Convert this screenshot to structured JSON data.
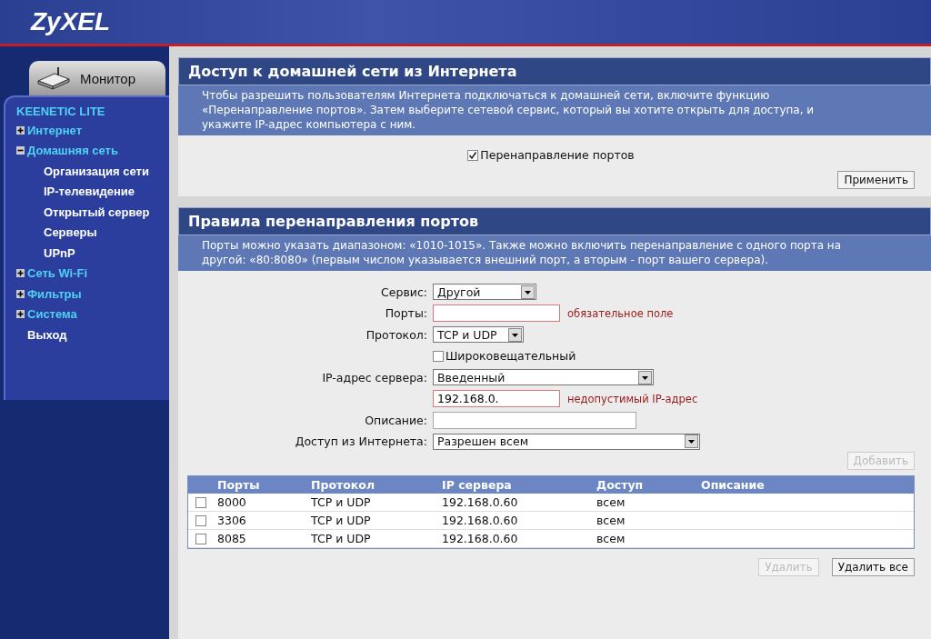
{
  "header": {
    "logo": "ZyXEL"
  },
  "sidebar": {
    "tab": "Монитор",
    "device": "KEENETIC LITE",
    "items": [
      {
        "label": "Интернет",
        "expanded": false
      },
      {
        "label": "Домашняя сеть",
        "expanded": true,
        "children": [
          {
            "label": "Организация сети"
          },
          {
            "label": "IP-телевидение"
          },
          {
            "label": "Открытый сервер"
          },
          {
            "label": "Серверы"
          },
          {
            "label": "UPnP"
          }
        ]
      },
      {
        "label": "Сеть Wi-Fi",
        "expanded": false
      },
      {
        "label": "Фильтры",
        "expanded": false
      },
      {
        "label": "Система",
        "expanded": false
      },
      {
        "label": "Выход"
      }
    ]
  },
  "access_section": {
    "title": "Доступ к домашней сети из Интернета",
    "description": "Чтобы разрешить пользователям Интернета подключаться к домашней сети, включите функцию «Перенаправление портов». Затем выберите сетевой сервис, который вы хотите открыть для доступа, и укажите IP-адрес компьютера с ним.",
    "checkbox": {
      "label": "Перенаправление портов",
      "checked": true
    },
    "apply_button": "Применить"
  },
  "rules_section": {
    "title": "Правила перенаправления портов",
    "description": "Порты можно указать диапазоном: «1010-1015». Также можно включить перенаправление с одного порта на другой: «80:8080» (первым числом указывается внешний порт, а вторым - порт вашего сервера).",
    "form": [
      {
        "kind": "select",
        "label": "Сервис:",
        "value": "Другой"
      },
      {
        "kind": "input",
        "label": "Порты:",
        "error": "обязательное поле",
        "invalid": true
      },
      {
        "kind": "select",
        "label": "Протокол:",
        "value": "TCP и UDP"
      },
      {
        "kind": "checkbox",
        "value": "Широковещательный",
        "checked": false
      },
      {
        "kind": "select",
        "label": "IP-адрес сервера:",
        "value": "Введенный"
      },
      {
        "kind": "input",
        "value": "192.168.0.",
        "error": "недопустимый IP-адрес",
        "invalid": true
      },
      {
        "kind": "input",
        "label": "Описание:",
        "invalid": false
      },
      {
        "kind": "select",
        "label": "Доступ из Интернета:",
        "value": "Разрешен всем"
      }
    ],
    "add_button": {
      "label": "Добавить",
      "disabled": true
    },
    "table": {
      "columns": [
        "Порты",
        "Протокол",
        "IP сервера",
        "Доступ",
        "Описание"
      ],
      "rows": [
        {
          "checked": false,
          "cells": [
            "8000",
            "TCP и UDP",
            "192.168.0.60",
            "всем"
          ]
        },
        {
          "checked": false,
          "cells": [
            "3306",
            "TCP и UDP",
            "192.168.0.60",
            "всем"
          ]
        },
        {
          "checked": false,
          "cells": [
            "8085",
            "TCP и UDP",
            "192.168.0.60",
            "всем"
          ]
        }
      ]
    },
    "buttons": [
      {
        "label": "Удалить",
        "disabled": true
      },
      {
        "label": "Удалить все",
        "disabled": false
      }
    ]
  }
}
